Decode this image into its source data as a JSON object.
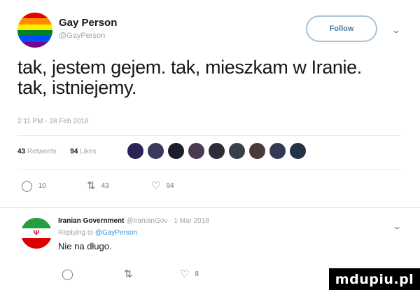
{
  "tweet": {
    "author_name": "Gay Person",
    "author_handle": "@GayPerson",
    "follow_label": "Follow",
    "text": "tak, jestem gejem. tak, mieszkam w Iranie. tak, istniejemy.",
    "timestamp": "2:11 PM - 28 Feb 2018",
    "retweets_count": "43",
    "retweets_label": "Retweets",
    "likes_count": "94",
    "likes_label": "Likes",
    "liker_avatar_colors": [
      "#2a2356",
      "#3b3a5e",
      "#1d1d2b",
      "#4b3a4f",
      "#2c2c3a",
      "#3a3f4c",
      "#4a3b3b",
      "#343a55",
      "#243447"
    ],
    "actions": {
      "replies": "10",
      "retweets": "43",
      "likes": "94"
    },
    "avatar_icon": "rainbow-flag-avatar"
  },
  "reply": {
    "author_name": "Iranian Government",
    "author_handle": "@IranianGov",
    "date": "1 Mar 2018",
    "replying_prefix": "Replying to",
    "replying_handle": "@GayPerson",
    "text": "Nie na długo.",
    "actions": {
      "replies": "",
      "retweets": "",
      "likes": "8"
    },
    "avatar_icon": "iran-flag-avatar"
  },
  "icons": {
    "reply": "speech-bubble-icon",
    "retweet": "retweet-arrows-icon",
    "like": "heart-icon",
    "caret": "chevron-down-icon"
  },
  "colors": {
    "rainbow": [
      "#e40303",
      "#ff8c00",
      "#ffed00",
      "#008026",
      "#004dff",
      "#750787"
    ],
    "iran": [
      "#239f40",
      "#ffffff",
      "#da0000"
    ],
    "follow_border": "#a9c3d8",
    "link": "#3b94d9"
  },
  "watermark": "mdupiu.pl"
}
